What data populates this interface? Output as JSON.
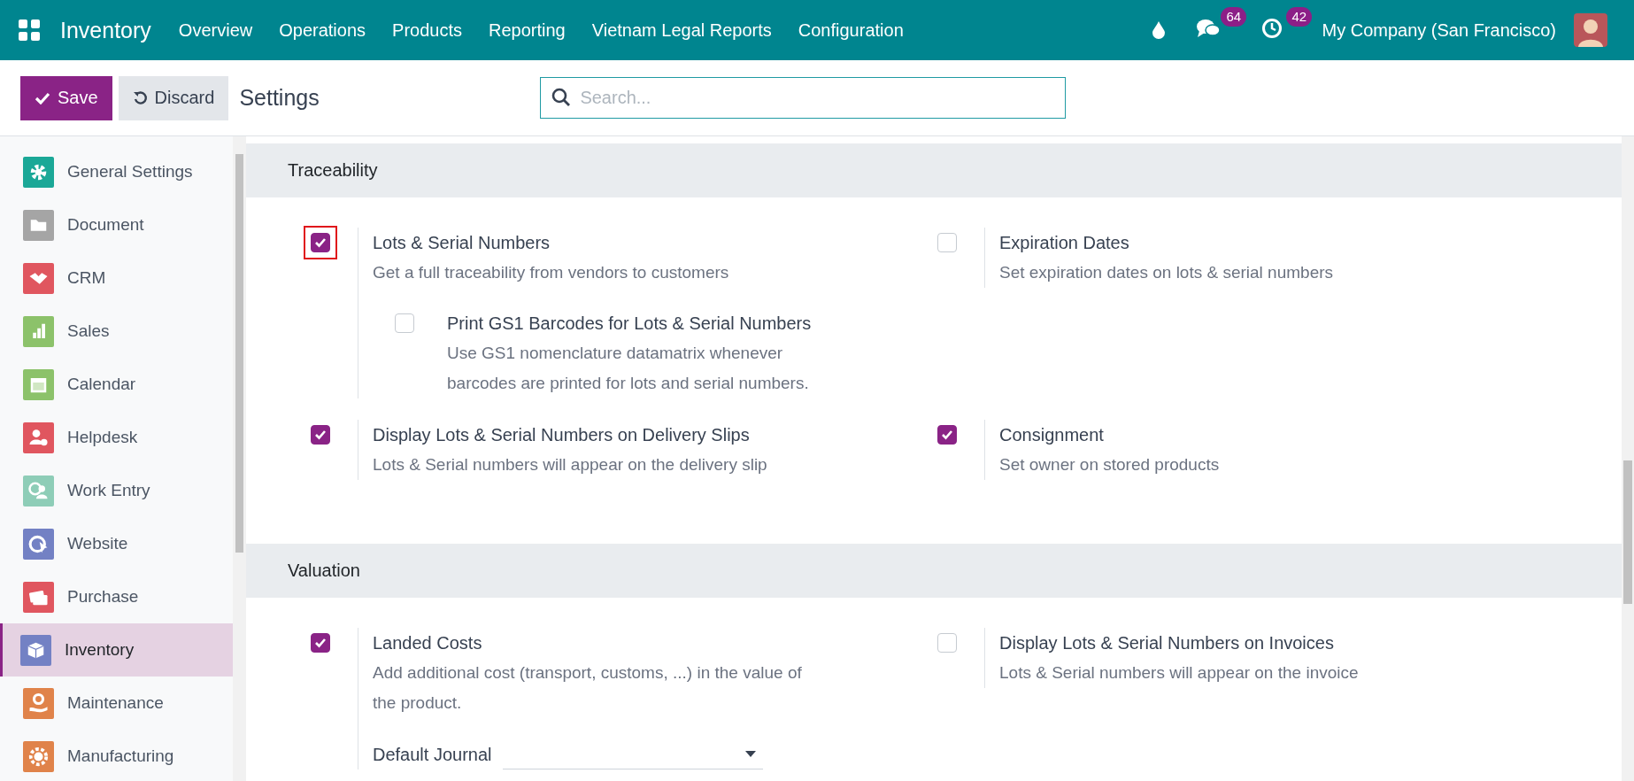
{
  "navbar": {
    "app_name": "Inventory",
    "menu": [
      "Overview",
      "Operations",
      "Products",
      "Reporting",
      "Vietnam Legal Reports",
      "Configuration"
    ],
    "messages_count": "64",
    "activities_count": "42",
    "company": "My Company (San Francisco)"
  },
  "control_panel": {
    "save": "Save",
    "discard": "Discard",
    "title": "Settings",
    "search": {
      "placeholder": "Search..."
    }
  },
  "sidebar": {
    "items": [
      {
        "label": "General Settings",
        "color": "#1ba897",
        "selected": false
      },
      {
        "label": "Document",
        "color": "#a5a5a5",
        "selected": false
      },
      {
        "label": "CRM",
        "color": "#e0565f",
        "selected": false
      },
      {
        "label": "Sales",
        "color": "#8cc26a",
        "selected": false
      },
      {
        "label": "Calendar",
        "color": "#8cc26a",
        "selected": false
      },
      {
        "label": "Helpdesk",
        "color": "#e0565f",
        "selected": false
      },
      {
        "label": "Work Entry",
        "color": "#8ecdb7",
        "selected": false
      },
      {
        "label": "Website",
        "color": "#7381c4",
        "selected": false
      },
      {
        "label": "Purchase",
        "color": "#e0565f",
        "selected": false
      },
      {
        "label": "Inventory",
        "color": "#7381c4",
        "selected": true
      },
      {
        "label": "Maintenance",
        "color": "#e0834a",
        "selected": false
      },
      {
        "label": "Manufacturing",
        "color": "#e0834a",
        "selected": false
      }
    ]
  },
  "sections": [
    {
      "title": "Traceability",
      "settings": [
        {
          "title": "Lots & Serial Numbers",
          "description": "Get a full traceability from vendors to customers",
          "checked": true,
          "highlighted": true,
          "children": [
            {
              "title": "Print GS1 Barcodes for Lots & Serial Numbers",
              "description": "Use GS1 nomenclature datamatrix whenever barcodes are printed for lots and serial numbers.",
              "checked": false
            }
          ]
        },
        {
          "title": "Expiration Dates",
          "description": "Set expiration dates on lots & serial numbers",
          "checked": false,
          "highlighted": false
        },
        {
          "title": "Display Lots & Serial Numbers on Delivery Slips",
          "description": "Lots & Serial numbers will appear on the delivery slip",
          "checked": true,
          "highlighted": false
        },
        {
          "title": "Consignment",
          "description": "Set owner on stored products",
          "checked": true,
          "highlighted": false
        }
      ]
    },
    {
      "title": "Valuation",
      "settings": [
        {
          "title": "Landed Costs",
          "description": "Add additional cost (transport, customs, ...) in the value of the product.",
          "checked": true,
          "highlighted": false,
          "field": {
            "label": "Default Journal"
          }
        },
        {
          "title": "Display Lots & Serial Numbers on Invoices",
          "description": "Lots & Serial numbers will appear on the invoice",
          "checked": false,
          "highlighted": false
        }
      ]
    }
  ]
}
